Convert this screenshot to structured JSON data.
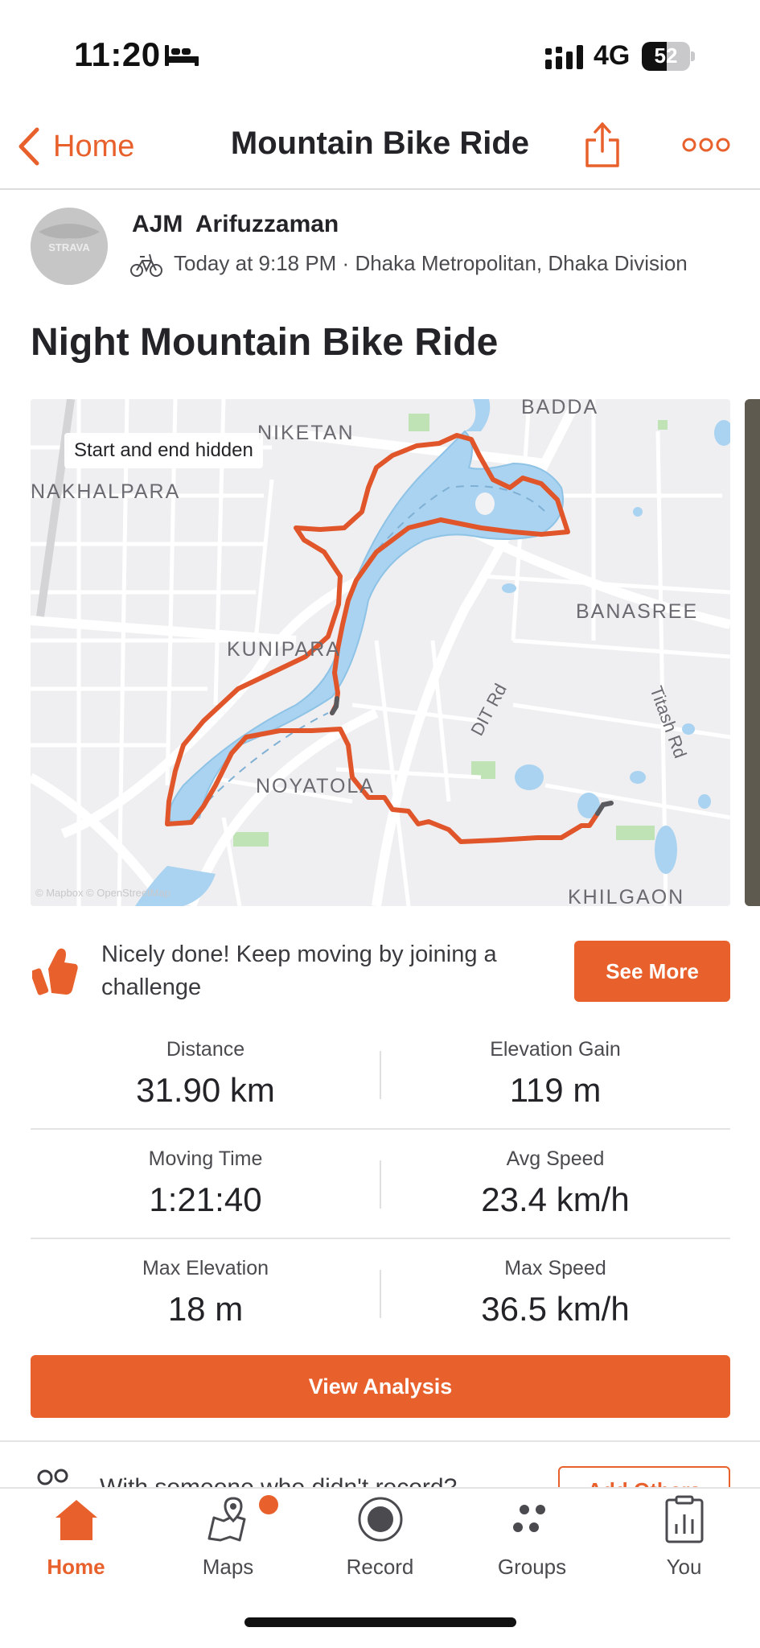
{
  "status_bar": {
    "time": "11:20",
    "network": "4G",
    "battery_level": "52",
    "battery_fraction": 0.52
  },
  "nav": {
    "back_label": "Home",
    "title": "Mountain Bike Ride",
    "share_icon": "share-icon",
    "more_icon": "more-icon"
  },
  "athlete": {
    "name": "AJM  Arifuzzaman",
    "avatar_text": "STRAVA",
    "meta": "Today at 9:18 PM · Dhaka Metropolitan, Dhaka Division"
  },
  "activity_title": "Night Mountain Bike Ride",
  "map": {
    "tag": "Start and end hidden",
    "labels": {
      "badda": "BADDA",
      "niketan": "NIKETAN",
      "nakhalpara": "NAKHALPARA",
      "banasree": "BANASREE",
      "kunipara": "KUNIPARA",
      "dit_rd": "DIT Rd",
      "titash_rd": "Titash Rd",
      "noyatola": "NOYATOLA",
      "khilgaon": "KHILGAON",
      "attribution": "© Mapbox © OpenStreetMap"
    },
    "route_color": "#e0562a"
  },
  "challenge": {
    "text": "Nicely done! Keep moving by joining a challenge",
    "button": "See More"
  },
  "stats": [
    {
      "label": "Distance",
      "value": "31.90 km"
    },
    {
      "label": "Elevation Gain",
      "value": "119 m"
    },
    {
      "label": "Moving Time",
      "value": "1:21:40"
    },
    {
      "label": "Avg Speed",
      "value": "23.4 km/h"
    },
    {
      "label": "Max Elevation",
      "value": "18 m"
    },
    {
      "label": "Max Speed",
      "value": "36.5 km/h"
    }
  ],
  "view_analysis": "View Analysis",
  "people_prompt": {
    "text": "With someone who didn't record?",
    "button": "Add Others"
  },
  "tabs": [
    {
      "label": "Home",
      "icon": "home-icon",
      "active": true
    },
    {
      "label": "Maps",
      "icon": "maps-icon",
      "active": false
    },
    {
      "label": "Record",
      "icon": "record-icon",
      "active": false
    },
    {
      "label": "Groups",
      "icon": "groups-icon",
      "active": false
    },
    {
      "label": "You",
      "icon": "you-icon",
      "active": false
    }
  ],
  "colors": {
    "accent": "#e8612c",
    "text": "#242428",
    "water": "#a9d3f0",
    "park": "#bfe3b4"
  }
}
